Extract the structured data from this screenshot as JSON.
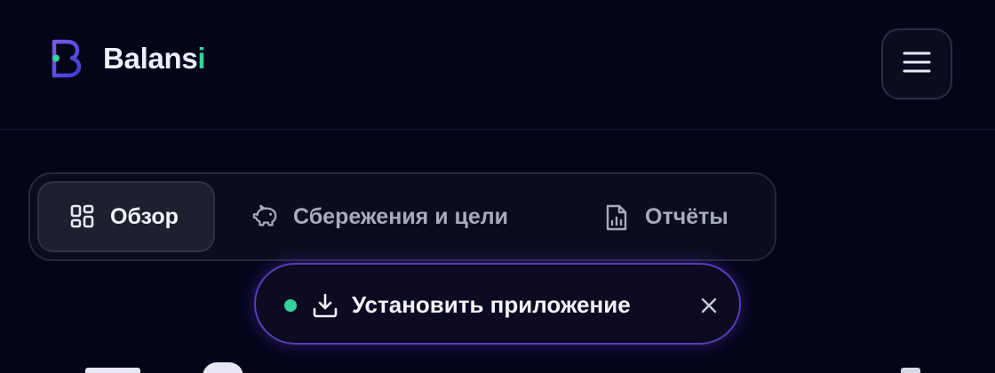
{
  "header": {
    "brand_main": "Balans",
    "brand_accent": "i",
    "logo_icon": "balansi-logo-icon",
    "menu_icon": "hamburger-menu-icon"
  },
  "tabs": [
    {
      "label": "Обзор",
      "icon": "dashboard-grid-icon",
      "active": true
    },
    {
      "label": "Сбережения и цели",
      "icon": "piggy-bank-icon",
      "active": false
    },
    {
      "label": "Отчёты",
      "icon": "report-chart-icon",
      "active": false
    }
  ],
  "install_banner": {
    "label": "Установить приложение",
    "status_color": "#34d399",
    "download_icon": "download-icon",
    "close_icon": "close-icon"
  },
  "colors": {
    "background": "#05051a",
    "accent_green": "#34d399",
    "accent_purple": "#5b3bb8"
  }
}
